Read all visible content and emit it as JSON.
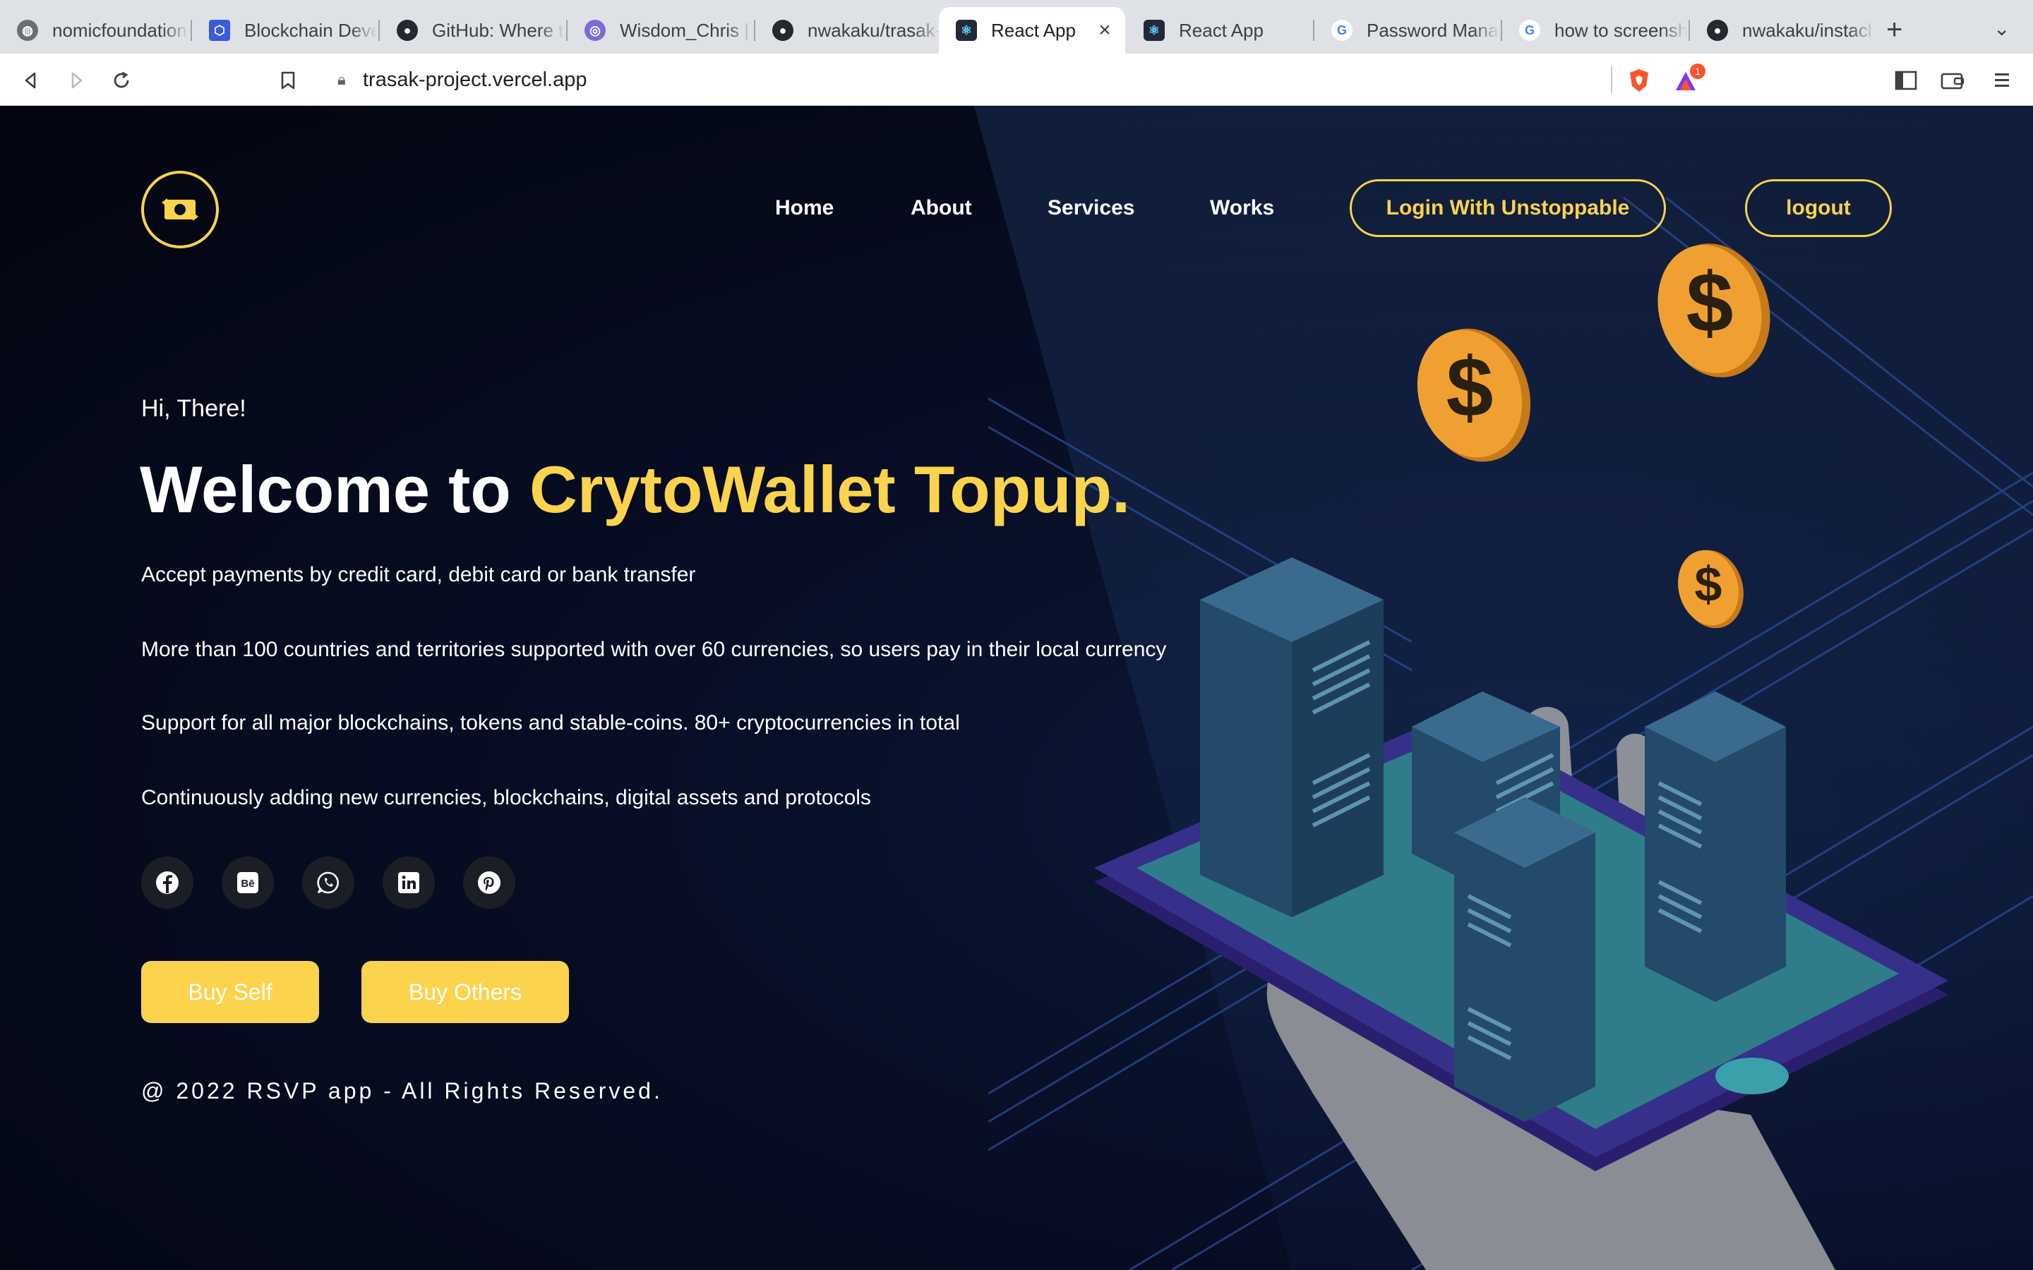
{
  "browser": {
    "tabs": [
      {
        "label": "nomicfoundation",
        "icon": "globe-icon",
        "color": "#6b6f75"
      },
      {
        "label": "Blockchain Deve",
        "icon": "hexagon-icon",
        "color": "#3b5bdb"
      },
      {
        "label": "GitHub: Where th",
        "icon": "github-icon",
        "color": "#24292f"
      },
      {
        "label": "Wisdom_Chris | F",
        "icon": "hashnode-icon",
        "color": "#7c6bd6"
      },
      {
        "label": "nwakaku/trasak-",
        "icon": "github-icon",
        "color": "#24292f"
      },
      {
        "label": "React App",
        "icon": "react-icon",
        "color": "#222a3a"
      },
      {
        "label": "React App",
        "icon": "react-icon",
        "color": "#222a3a"
      },
      {
        "label": "Password Manag",
        "icon": "google-icon",
        "color": "#ffffff"
      },
      {
        "label": "how to screensho",
        "icon": "google-icon",
        "color": "#ffffff"
      },
      {
        "label": "nwakaku/instacl",
        "icon": "github-icon",
        "color": "#24292f"
      }
    ],
    "active_tab": 5,
    "close_glyph": "×",
    "new_tab_glyph": "+",
    "url": "trasak-project.vercel.app",
    "brave_badge": "1"
  },
  "site": {
    "accent": "#fcd34d",
    "nav": {
      "links": [
        "Home",
        "About",
        "Services",
        "Works"
      ],
      "login_button": "Login With Unstoppable",
      "logout_button": "logout"
    },
    "hero": {
      "greeting": "Hi, There!",
      "title_plain": "Welcome to ",
      "title_highlight": "CrytoWallet Topup.",
      "paragraphs": [
        "Accept payments by credit card, debit card or bank transfer",
        "More than 100 countries and territories supported with over 60 currencies, so users pay in their local currency",
        "Support for all major blockchains, tokens and stable-coins. 80+ cryptocurrencies in total",
        "Continuously adding new currencies, blockchains, digital assets and protocols"
      ],
      "social_icons": [
        "facebook-icon",
        "behance-icon",
        "whatsapp-icon",
        "linkedin-icon",
        "pinterest-icon"
      ],
      "buy_self": "Buy Self",
      "buy_others": "Buy Others",
      "copyright": "@ 2022 RSVP app - All Rights Reserved."
    }
  }
}
